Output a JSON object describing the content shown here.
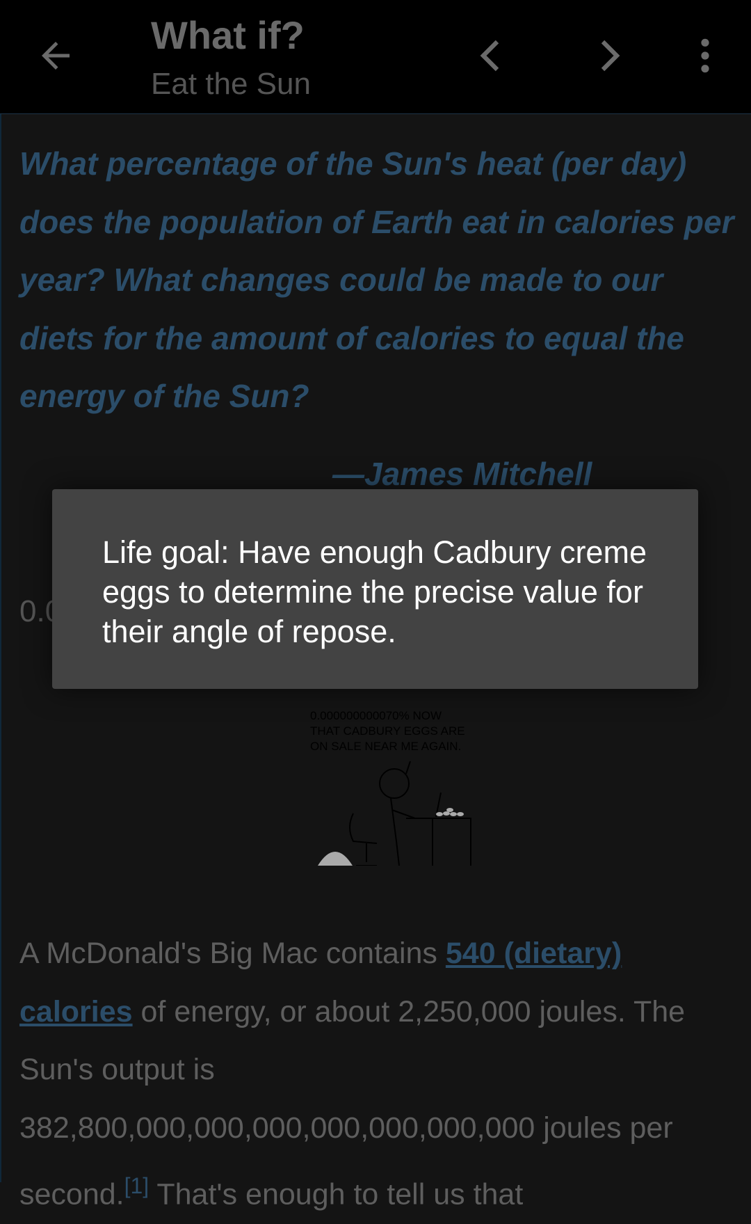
{
  "appbar": {
    "title": "What if?",
    "subtitle": "Eat the Sun",
    "back_icon": "arrow-left-icon",
    "prev_icon": "chevron-left-icon",
    "next_icon": "chevron-right-icon",
    "menu_icon": "more-vert-icon"
  },
  "article": {
    "question": "What percentage of the Sun's heat (per day) does the population of Earth eat in calories per year? What changes could be made to our diets for the amount of calories to equal the energy of the Sun?",
    "attribution": "—James Mitchell",
    "hidden_fragment": "0.0",
    "comic_caption": [
      "0.000000000070% NOW",
      "THAT CADBURY EGGS ARE",
      "ON SALE NEAR ME AGAIN."
    ],
    "para_part1": "A McDonald's Big Mac contains ",
    "para_link": "540 (dietary) calories",
    "para_part2": " of energy, or about 2,250,000 joules. The Sun's output is 382,800,000,000,000,000,000,000,000 joules per second.",
    "footnote": "[1]",
    "para_part3": " That's enough to tell us that"
  },
  "tooltip": {
    "text": "Life goal: Have enough Cadbury creme eggs to determine the precise value for their angle of repose."
  },
  "colors": {
    "accent": "#2b4d69",
    "appbar": "#000000",
    "background": "#141414",
    "tooltip": "#434343"
  }
}
